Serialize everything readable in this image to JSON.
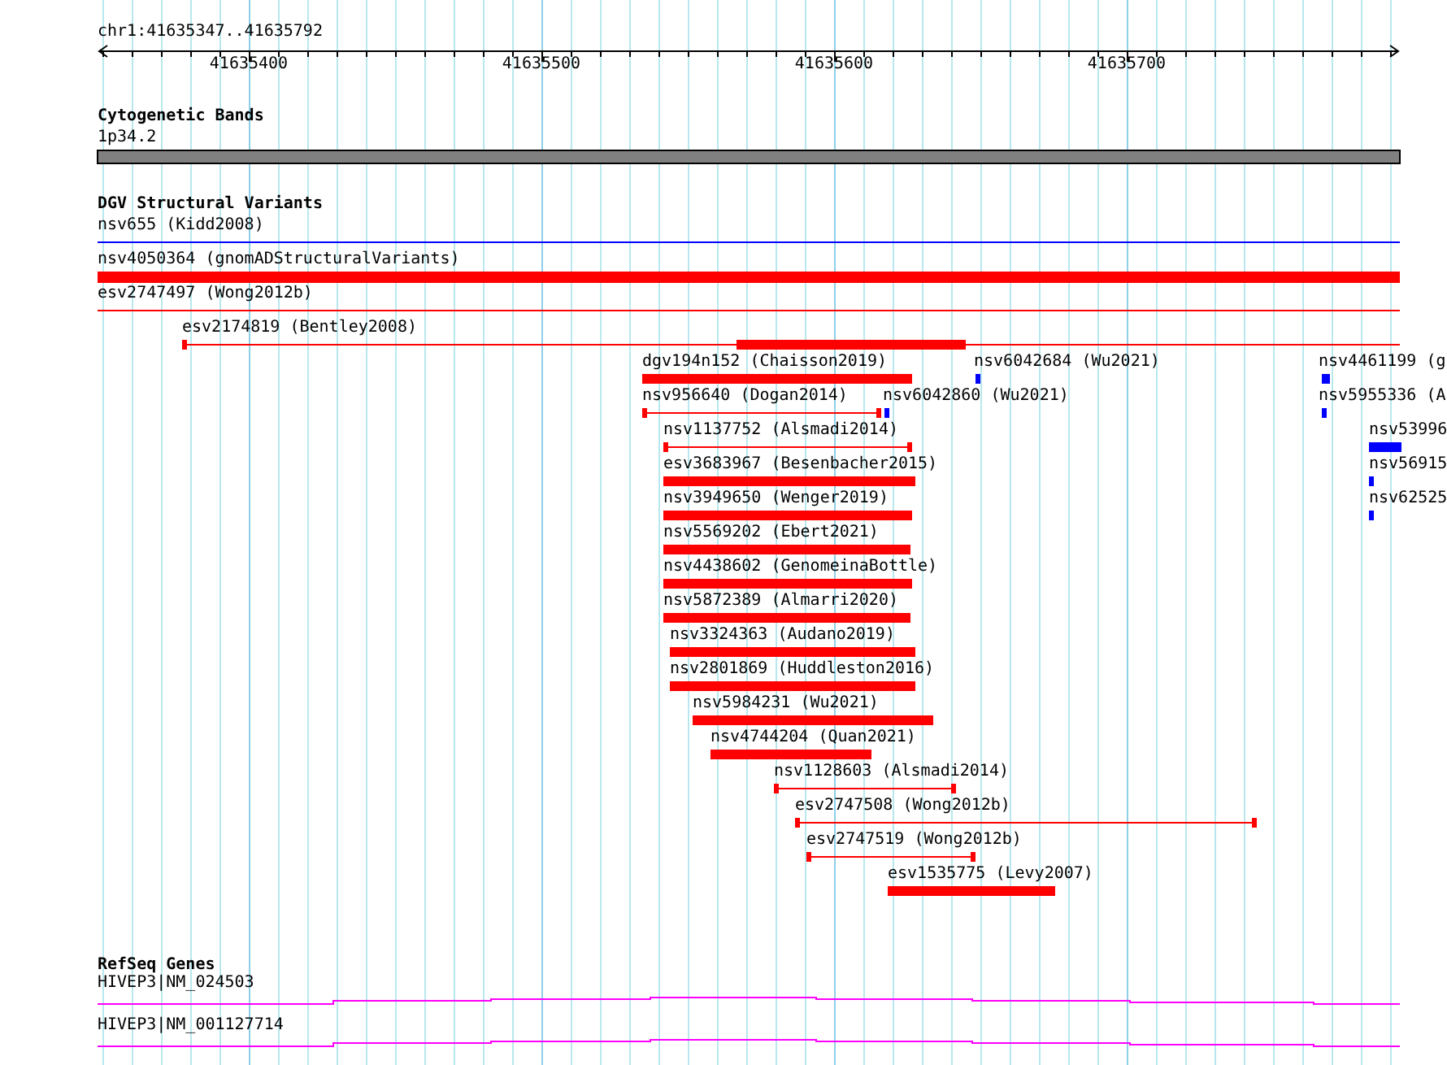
{
  "ruler": {
    "location": "chr1:41635347..41635792",
    "ticks": [
      "41635400",
      "41635500",
      "41635600",
      "41635700"
    ]
  },
  "cytogenetic_bands": {
    "title": "Cytogenetic Bands",
    "bands": [
      {
        "label": "1p34.2"
      }
    ]
  },
  "dgv_structural_variants": {
    "title": "DGV Structural Variants",
    "features": [
      {
        "label": "nsv655 (Kidd2008)",
        "kind": "line",
        "color": "#0000ff"
      },
      {
        "label": "nsv4050364 (gnomADStructuralVariants)",
        "kind": "bar",
        "color": "#ff0000"
      },
      {
        "label": "esv2747497 (Wong2012b)",
        "kind": "line",
        "color": "#ff0000"
      },
      {
        "label": "esv2174819 (Bentley2008)",
        "kind": "split",
        "color": "#ff0000"
      },
      {
        "label": "dgv194n152 (Chaisson2019)",
        "kind": "bar",
        "color": "#ff0000"
      },
      {
        "label": "nsv6042684 (Wu2021)",
        "kind": "bar",
        "color": "#0000ff"
      },
      {
        "label": "nsv4461199 (g",
        "kind": "bar",
        "color": "#0000ff"
      },
      {
        "label": "nsv956640 (Dogan2014)",
        "kind": "capped",
        "color": "#ff0000"
      },
      {
        "label": "nsv6042860 (Wu2021)",
        "kind": "bar",
        "color": "#0000ff"
      },
      {
        "label": "nsv5955336 (A",
        "kind": "bar",
        "color": "#0000ff"
      },
      {
        "label": "nsv1137752 (Alsmadi2014)",
        "kind": "capped",
        "color": "#ff0000"
      },
      {
        "label": "nsv53996",
        "kind": "bar",
        "color": "#0000ff"
      },
      {
        "label": "esv3683967 (Besenbacher2015)",
        "kind": "bar",
        "color": "#ff0000"
      },
      {
        "label": "nsv56915",
        "kind": "bar",
        "color": "#0000ff"
      },
      {
        "label": "nsv3949650 (Wenger2019)",
        "kind": "bar",
        "color": "#ff0000"
      },
      {
        "label": "nsv62525",
        "kind": "bar",
        "color": "#0000ff"
      },
      {
        "label": "nsv5569202 (Ebert2021)",
        "kind": "bar",
        "color": "#ff0000"
      },
      {
        "label": "nsv4438602 (GenomeinaBottle)",
        "kind": "bar",
        "color": "#ff0000"
      },
      {
        "label": "nsv5872389 (Almarri2020)",
        "kind": "bar",
        "color": "#ff0000"
      },
      {
        "label": "nsv3324363 (Audano2019)",
        "kind": "bar",
        "color": "#ff0000"
      },
      {
        "label": "nsv2801869 (Huddleston2016)",
        "kind": "bar",
        "color": "#ff0000"
      },
      {
        "label": "nsv5984231 (Wu2021)",
        "kind": "bar",
        "color": "#ff0000"
      },
      {
        "label": "nsv4744204 (Quan2021)",
        "kind": "bar",
        "color": "#ff0000"
      },
      {
        "label": "nsv1128603 (Alsmadi2014)",
        "kind": "capped",
        "color": "#ff0000"
      },
      {
        "label": "esv2747508 (Wong2012b)",
        "kind": "capped",
        "color": "#ff0000"
      },
      {
        "label": "esv2747519 (Wong2012b)",
        "kind": "capped",
        "color": "#ff0000"
      },
      {
        "label": "esv1535775 (Levy2007)",
        "kind": "bar",
        "color": "#ff0000"
      }
    ]
  },
  "refseq_genes": {
    "title": "RefSeq Genes",
    "genes": [
      {
        "label": "HIVEP3|NM_024503"
      },
      {
        "label": "HIVEP3|NM_001127714"
      }
    ]
  }
}
